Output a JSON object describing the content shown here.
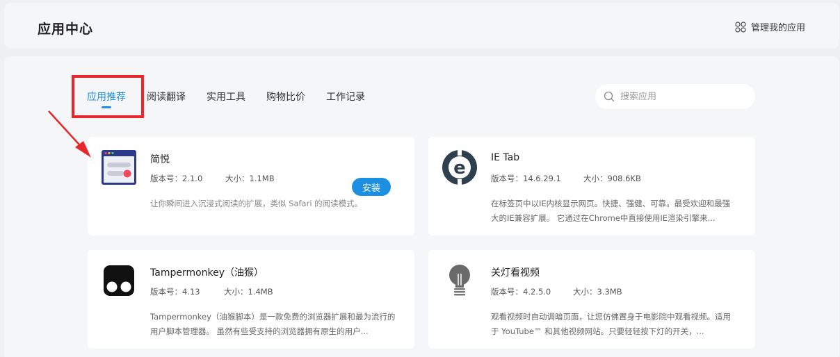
{
  "header": {
    "title": "应用中心",
    "manage_label": "管理我的应用"
  },
  "tabs": [
    {
      "label": "应用推荐",
      "active": true
    },
    {
      "label": "阅读翻译"
    },
    {
      "label": "实用工具"
    },
    {
      "label": "购物比价"
    },
    {
      "label": "工作记录"
    }
  ],
  "search": {
    "placeholder": "搜索应用",
    "value": ""
  },
  "accent_color": "#1d8fe0",
  "highlight_color": "#e8262b",
  "apps": [
    {
      "icon": "browser-window-icon",
      "name": "简悦",
      "version": "版本号：2.1.0",
      "size": "大小：1.1MB",
      "action": "安装",
      "desc": "让你瞬间进入沉浸式阅读的扩展，类似 Safari 的阅读模式。"
    },
    {
      "icon": "ie-tab-icon",
      "name": "IE Tab",
      "version": "版本号：14.6.29.1",
      "size": "大小：908.6KB",
      "desc": "在标签页中以IE内核显示网页。快捷、强健、可靠。最受欢迎和最强大的IE兼容扩展。 它通过在Chrome中直接使用IE渲染引擎来..."
    },
    {
      "icon": "tampermonkey-icon",
      "name": "Tampermonkey（油猴）",
      "version": "版本号：4.13",
      "size": "大小：1.4MB",
      "desc": "Tampermonkey（油猴脚本）是一款免费的浏览器扩展和最为流行的用户脚本管理器。 虽然有些受支持的浏览器拥有原生的用户..."
    },
    {
      "icon": "light-bulb-icon",
      "name": "关灯看视频",
      "version": "版本号：4.2.5.0",
      "size": "大小：3.3MB",
      "desc": "观看视频时自动调暗页面，让您仿佛置身于电影院中观看视频。适用于 YouTube™ 和其他视频网站。只要轻轻按下灯的开关，..."
    }
  ]
}
